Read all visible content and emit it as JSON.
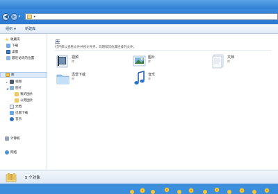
{
  "window": {
    "breadcrumb_separator": "▸",
    "address_dropdown_arrow": "▸"
  },
  "toolbar": {
    "organize_label": "组织",
    "new_library_label": "新建库",
    "caret": "▼"
  },
  "nav_buttons": {
    "back_glyph": "◀",
    "forward_glyph": "▶",
    "history_glyph": "▾"
  },
  "sidebar": {
    "favorites": {
      "label": "收藏夹",
      "items": [
        {
          "label": "下载",
          "icon": "download-folder-icon"
        },
        {
          "label": "桌面",
          "icon": "desktop-icon"
        },
        {
          "label": "最近访问的位置",
          "icon": "recent-places-icon"
        }
      ]
    },
    "libraries": {
      "label": "库",
      "selected": true,
      "items": [
        {
          "label": "视频",
          "icon": "video-icon",
          "level": 1
        },
        {
          "label": "图片",
          "icon": "pictures-icon",
          "level": 1
        },
        {
          "label": "我的图片",
          "icon": "folder-icon",
          "level": 2
        },
        {
          "label": "公用图片",
          "icon": "folder-icon",
          "level": 2
        },
        {
          "label": "文档",
          "icon": "documents-icon",
          "level": 1
        },
        {
          "label": "迅雷下载",
          "icon": "download-icon",
          "level": 1
        },
        {
          "label": "音乐",
          "icon": "music-icon",
          "level": 1
        }
      ]
    },
    "computer": {
      "label": "计算机"
    },
    "network": {
      "label": "网络"
    }
  },
  "content": {
    "title": "库",
    "subtitle": "打开库以查看文件并按文件夹、日期和其他属性排列文件。",
    "tiles": [
      {
        "name": "视频",
        "sub": "库",
        "icon": "video-library-icon"
      },
      {
        "name": "图片",
        "sub": "库",
        "icon": "pictures-library-icon"
      },
      {
        "name": "文档",
        "sub": "库",
        "icon": "documents-library-icon"
      },
      {
        "name": "迅雷下载",
        "sub": "库",
        "icon": "download-library-icon"
      },
      {
        "name": "音乐",
        "sub": "库",
        "icon": "music-library-icon"
      }
    ]
  },
  "details": {
    "count_text": "5 个对象"
  },
  "colors": {
    "title_bar": "#3d8fe0",
    "toolbar": "#e7eff8",
    "selection": "#dbe9f9",
    "desktop": "#3b8edc"
  }
}
